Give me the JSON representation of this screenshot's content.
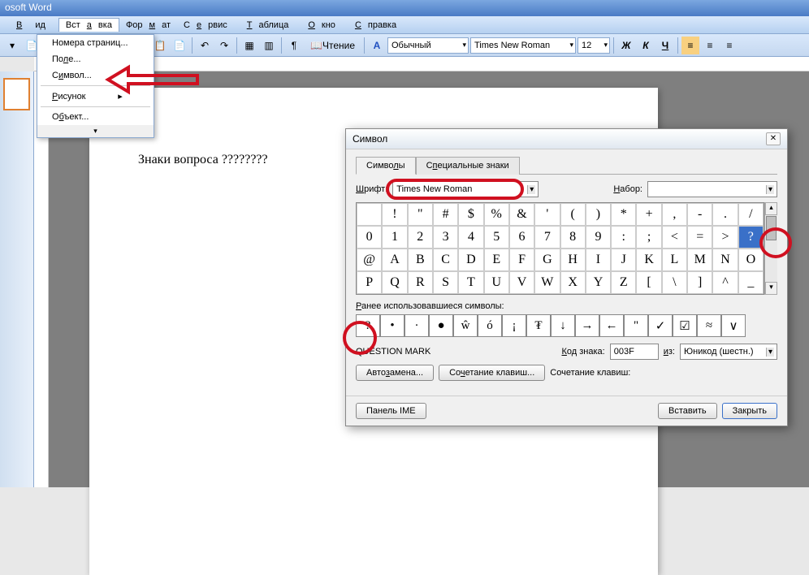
{
  "app_title": "osoft Word",
  "menu": {
    "view": "Вид",
    "insert": "Вставка",
    "format": "Формат",
    "service": "Сервис",
    "table": "Таблица",
    "window": "Окно",
    "help": "Справка"
  },
  "toolbar": {
    "read": "Чтение",
    "style": "Обычный",
    "font": "Times New Roman",
    "size": "12",
    "bold": "Ж",
    "italic": "К",
    "underline": "Ч"
  },
  "dropdown": {
    "i0": "Номера страниц...",
    "i1": "Поле...",
    "i2": "Символ...",
    "i3": "Рисунок",
    "i4": "Объект..."
  },
  "doc_text": "Знаки вопроса ????????",
  "dialog": {
    "title": "Символ",
    "tab1": "Символы",
    "tab2": "Специальные знаки",
    "font_lbl": "Шрифт:",
    "font_val": "Times New Roman",
    "set_lbl": "Набор:",
    "recent_lbl": "Ранее использовавшиеся символы:",
    "name": "QUESTION MARK",
    "code_lbl": "Код знака:",
    "code_val": "003F",
    "from_lbl": "из:",
    "from_val": "Юникод (шестн.)",
    "auto": "Автозамена...",
    "shortcut": "Сочетание клавиш...",
    "shortcut_lbl": "Сочетание клавиш:",
    "ime": "Панель IME",
    "insert": "Вставить",
    "close": "Закрыть"
  },
  "chart_data": {
    "type": "table",
    "grid": [
      [
        " ",
        "!",
        "\"",
        "#",
        "$",
        "%",
        "&",
        "'",
        "(",
        ")",
        "*",
        "+",
        ",",
        "-",
        ".",
        "/"
      ],
      [
        "0",
        "1",
        "2",
        "3",
        "4",
        "5",
        "6",
        "7",
        "8",
        "9",
        ":",
        ";",
        "<",
        "=",
        ">",
        "?"
      ],
      [
        "@",
        "A",
        "B",
        "C",
        "D",
        "E",
        "F",
        "G",
        "H",
        "I",
        "J",
        "K",
        "L",
        "M",
        "N",
        "O"
      ],
      [
        "P",
        "Q",
        "R",
        "S",
        "T",
        "U",
        "V",
        "W",
        "X",
        "Y",
        "Z",
        "[",
        "\\",
        "]",
        "^",
        "_"
      ]
    ],
    "selected": "?",
    "recent": [
      "?",
      "•",
      "·",
      "●",
      "ŵ",
      "ó",
      "¡",
      "₮",
      "↓",
      "→",
      "←",
      "\"",
      "✓",
      "☑",
      "≈",
      "∨"
    ]
  }
}
